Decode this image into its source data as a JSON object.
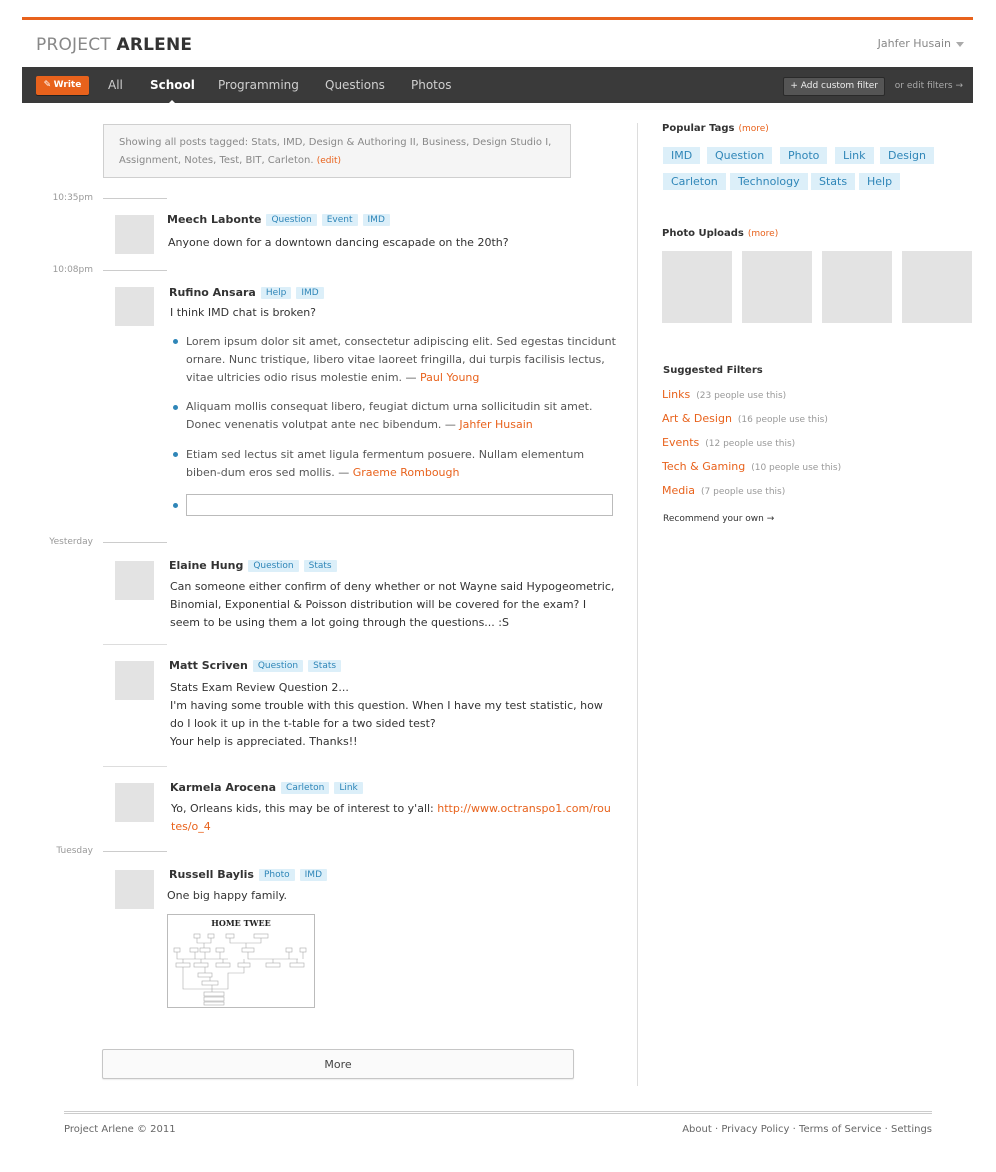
{
  "header": {
    "logo_part1": "PROJECT ",
    "logo_part2": "ARLENE",
    "user_name": "Jahfer Husain",
    "accent_color": "#e8621c"
  },
  "nav": {
    "write_label": "Write",
    "tabs": [
      {
        "label": "All",
        "active": false
      },
      {
        "label": "School",
        "active": true
      },
      {
        "label": "Programming",
        "active": false
      },
      {
        "label": "Questions",
        "active": false
      },
      {
        "label": "Photos",
        "active": false
      }
    ],
    "add_filter_label": "Add custom filter",
    "edit_filters_label": "or edit filters →"
  },
  "filter_notice": {
    "text": "Showing all posts tagged: Stats, IMD, Design & Authoring II, Business, Design Studio I, Assignment, Notes, Test, BIT, Carleton.",
    "edit_label": "(edit)"
  },
  "feed": {
    "time_labels": [
      "10:35pm",
      "10:08pm",
      "Yesterday",
      "Tuesday"
    ],
    "posts": [
      {
        "author": "Meech Labonte",
        "tags": [
          "Question",
          "Event",
          "IMD"
        ],
        "text": "Anyone down for a downtown dancing escapade on the 20th?"
      },
      {
        "author": "Rufino Ansara",
        "tags": [
          "Help",
          "IMD"
        ],
        "text": "I think IMD chat is broken?",
        "replies": [
          {
            "text": "Lorem ipsum dolor sit amet, consectetur adipiscing elit. Sed egestas tincidunt ornare. Nunc tristique, libero vitae laoreet fringilla, dui turpis facilisis lectus, vitae ultricies odio risus molestie enim. — ",
            "author": "Paul Young"
          },
          {
            "text": "Aliquam mollis consequat libero, feugiat dictum urna sollicitudin sit amet. Donec venenatis volutpat ante nec bibendum. — ",
            "author": "Jahfer Husain"
          },
          {
            "text": "Etiam sed lectus sit amet ligula fermentum posuere. Nullam elementum biben-dum eros sed mollis. — ",
            "author": "Graeme Rombough"
          }
        ]
      },
      {
        "author": "Elaine Hung",
        "tags": [
          "Question",
          "Stats"
        ],
        "text": "Can someone either confirm of deny whether or not Wayne said Hypogeometric, Binomial, Exponential & Poisson distribution will be covered for the exam? I seem to be using them a lot going through the questions... :S"
      },
      {
        "author": "Matt Scriven",
        "tags": [
          "Question",
          "Stats"
        ],
        "lines": [
          "Stats Exam Review Question 2...",
          "I'm having some trouble with this question. When I have my test statistic, how do I look it up in the t-table for a two sided test?",
          "Your help is appreciated. Thanks!!"
        ]
      },
      {
        "author": "Karmela Arocena",
        "tags": [
          "Carleton",
          "Link"
        ],
        "text": "Yo, Orleans kids, this may be of interest to y'all: ",
        "link": "http://www.octranspo1.com/routes/o_4"
      },
      {
        "author": "Russell Baylis",
        "tags": [
          "Photo",
          "IMD"
        ],
        "text": "One big happy family.",
        "image_title": "HOME TWEE"
      }
    ],
    "more_label": "More"
  },
  "sidebar": {
    "popular_tags_title": "Popular Tags",
    "popular_more": "(more)",
    "popular_tags": [
      "IMD",
      "Question",
      "Photo",
      "Link",
      "Design",
      "Carleton",
      "Technology",
      "Stats",
      "Help"
    ],
    "photo_uploads_title": "Photo Uploads",
    "photo_more": "(more)",
    "suggested_title": "Suggested Filters",
    "suggested": [
      {
        "name": "Links",
        "count": "(23 people use this)"
      },
      {
        "name": "Art & Design",
        "count": "(16 people use this)"
      },
      {
        "name": "Events",
        "count": "(12 people use this)"
      },
      {
        "name": "Tech & Gaming",
        "count": "(10 people use this)"
      },
      {
        "name": "Media",
        "count": "(7 people use this)"
      }
    ],
    "recommend_label": "Recommend your own →"
  },
  "footer": {
    "copyright": "Project Arlene © 2011",
    "links": [
      "About",
      "Privacy Policy",
      "Terms of Service",
      "Settings"
    ]
  }
}
